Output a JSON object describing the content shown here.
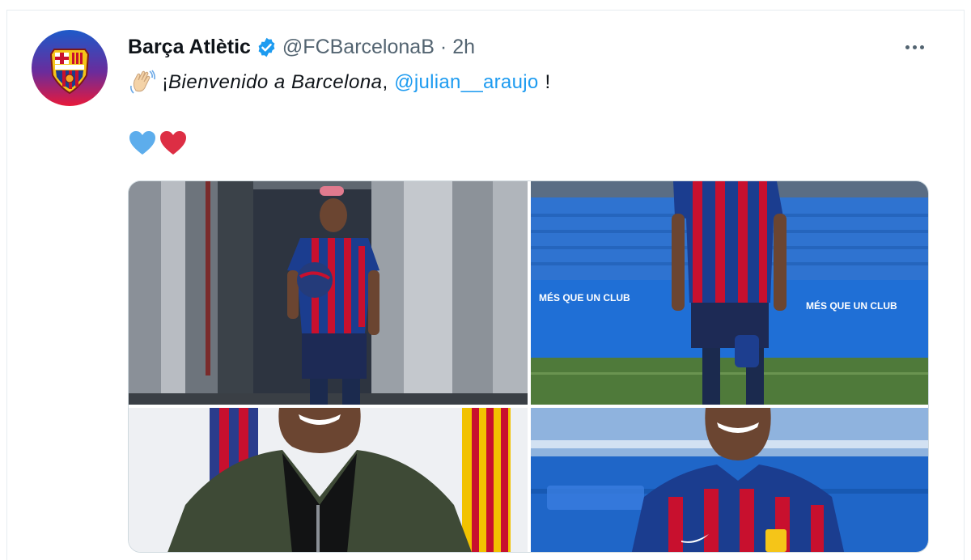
{
  "tweet": {
    "display_name": "Barça Atlètic",
    "handle": "@FCBarcelonaB",
    "separator": "·",
    "time": "2h",
    "text_prefix": "¡",
    "text_italic": "Bienvenido a Barcelona",
    "text_comma": ",",
    "mention": "@julian__araujo",
    "text_suffix": "!",
    "verified_color": "#1d9bf0",
    "mention_color": "#1d9bf0"
  },
  "media": {
    "photos": [
      {
        "name": "player-corridor-photo"
      },
      {
        "name": "player-stadium-photo"
      },
      {
        "name": "player-jacket-photo"
      },
      {
        "name": "player-kit-closeup-photo"
      }
    ],
    "wall_text_left": "MÉS QUE UN CLUB",
    "wall_text_right": "MÉS QUE UN CLUB"
  },
  "colors": {
    "barca_blue": "#1b3d8f",
    "barca_red": "#c8102e",
    "stand_blue": "#2f73d0",
    "pitch_green": "#4f7a3a"
  }
}
